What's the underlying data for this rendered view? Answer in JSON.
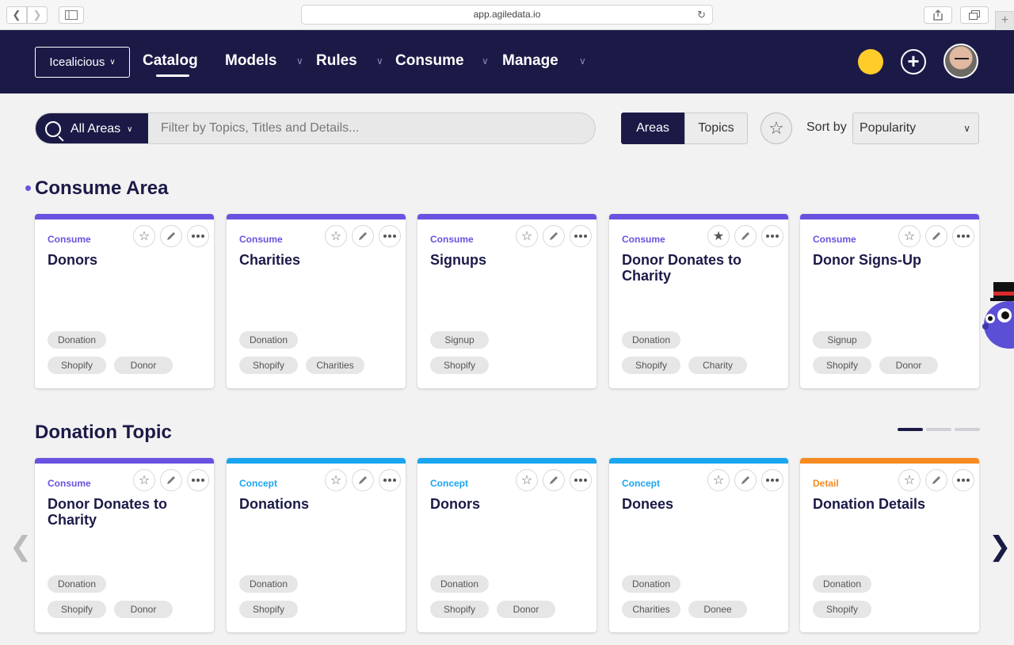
{
  "browser": {
    "url": "app.agiledata.io"
  },
  "header": {
    "workspace": "Icealicious",
    "nav": [
      {
        "label": "Catalog",
        "active": true
      },
      {
        "label": "Models"
      },
      {
        "label": "Rules"
      },
      {
        "label": "Consume"
      },
      {
        "label": "Manage"
      }
    ]
  },
  "filters": {
    "area_select": "All Areas",
    "search_placeholder": "Filter by Topics, Titles and Details...",
    "view_toggle": [
      "Areas",
      "Topics"
    ],
    "sort_label": "Sort by",
    "sort_value": "Popularity"
  },
  "colors": {
    "consume": "#6a52e0",
    "concept": "#1aa5f0",
    "detail": "#f58a1f",
    "nav_bg": "#1b1a47",
    "status": "#ffcc2a"
  },
  "sections": [
    {
      "title": "Consume Area",
      "cards": [
        {
          "type": "Consume",
          "title": "Donors",
          "starred": false,
          "tags": [
            [
              "Donation"
            ],
            [
              "Shopify",
              "Donor"
            ]
          ]
        },
        {
          "type": "Consume",
          "title": "Charities",
          "starred": false,
          "tags": [
            [
              "Donation"
            ],
            [
              "Shopify",
              "Charities"
            ]
          ]
        },
        {
          "type": "Consume",
          "title": "Signups",
          "starred": false,
          "tags": [
            [
              "Signup"
            ],
            [
              "Shopify"
            ]
          ]
        },
        {
          "type": "Consume",
          "title": "Donor Donates to Charity",
          "starred": true,
          "tags": [
            [
              "Donation"
            ],
            [
              "Shopify",
              "Charity"
            ]
          ]
        },
        {
          "type": "Consume",
          "title": "Donor Signs-Up",
          "starred": false,
          "tags": [
            [
              "Signup"
            ],
            [
              "Shopify",
              "Donor"
            ]
          ]
        }
      ]
    },
    {
      "title": "Donation Topic",
      "pager": {
        "pages": 3,
        "current": 1
      },
      "cards": [
        {
          "type": "Consume",
          "title": "Donor Donates to Charity",
          "starred": false,
          "tags": [
            [
              "Donation"
            ],
            [
              "Shopify",
              "Donor"
            ]
          ]
        },
        {
          "type": "Concept",
          "title": "Donations",
          "starred": false,
          "tags": [
            [
              "Donation"
            ],
            [
              "Shopify"
            ]
          ]
        },
        {
          "type": "Concept",
          "title": "Donors",
          "starred": false,
          "tags": [
            [
              "Donation"
            ],
            [
              "Shopify",
              "Donor"
            ]
          ]
        },
        {
          "type": "Concept",
          "title": "Donees",
          "starred": false,
          "tags": [
            [
              "Donation"
            ],
            [
              "Charities",
              "Donee"
            ]
          ]
        },
        {
          "type": "Detail",
          "title": "Donation Details",
          "starred": false,
          "tags": [
            [
              "Donation"
            ],
            [
              "Shopify"
            ]
          ]
        }
      ]
    }
  ]
}
